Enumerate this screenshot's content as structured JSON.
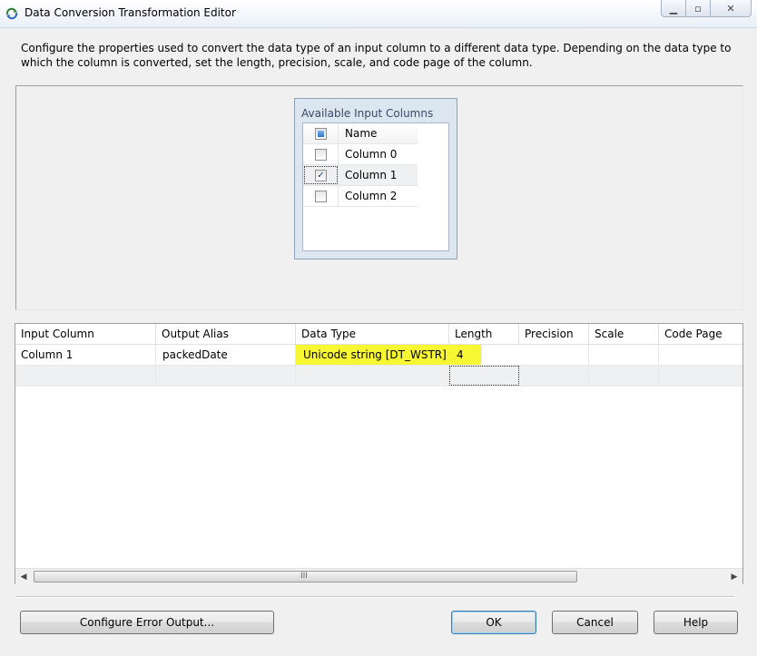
{
  "window": {
    "title": "Data Conversion Transformation Editor",
    "icon": "data-conversion-icon",
    "buttons": {
      "minimize": "▁",
      "maximize": "▫",
      "close": "✕"
    }
  },
  "description": "Configure the properties used to convert the data type of an input column to a different data type. Depending on the data type to which the column is converted, set the length, precision, scale, and code page of the column.",
  "available_input_columns": {
    "title": "Available Input Columns",
    "header": "Name",
    "columns": [
      {
        "name": "Column 0",
        "checked": false
      },
      {
        "name": "Column 1",
        "checked": true
      },
      {
        "name": "Column 2",
        "checked": false
      }
    ]
  },
  "grid": {
    "headers": [
      "Input Column",
      "Output Alias",
      "Data Type",
      "Length",
      "Precision",
      "Scale",
      "Code Page"
    ],
    "rows": [
      {
        "input_column": "Column 1",
        "output_alias": "packedDate",
        "data_type": "Unicode string [DT_WSTR]",
        "length": "4",
        "precision": "",
        "scale": "",
        "code_page": ""
      }
    ],
    "highlight_color": "#f7f733",
    "scroll_grip": "III"
  },
  "buttons": {
    "configure_error_output": "Configure Error Output...",
    "ok": "OK",
    "cancel": "Cancel",
    "help": "Help"
  }
}
